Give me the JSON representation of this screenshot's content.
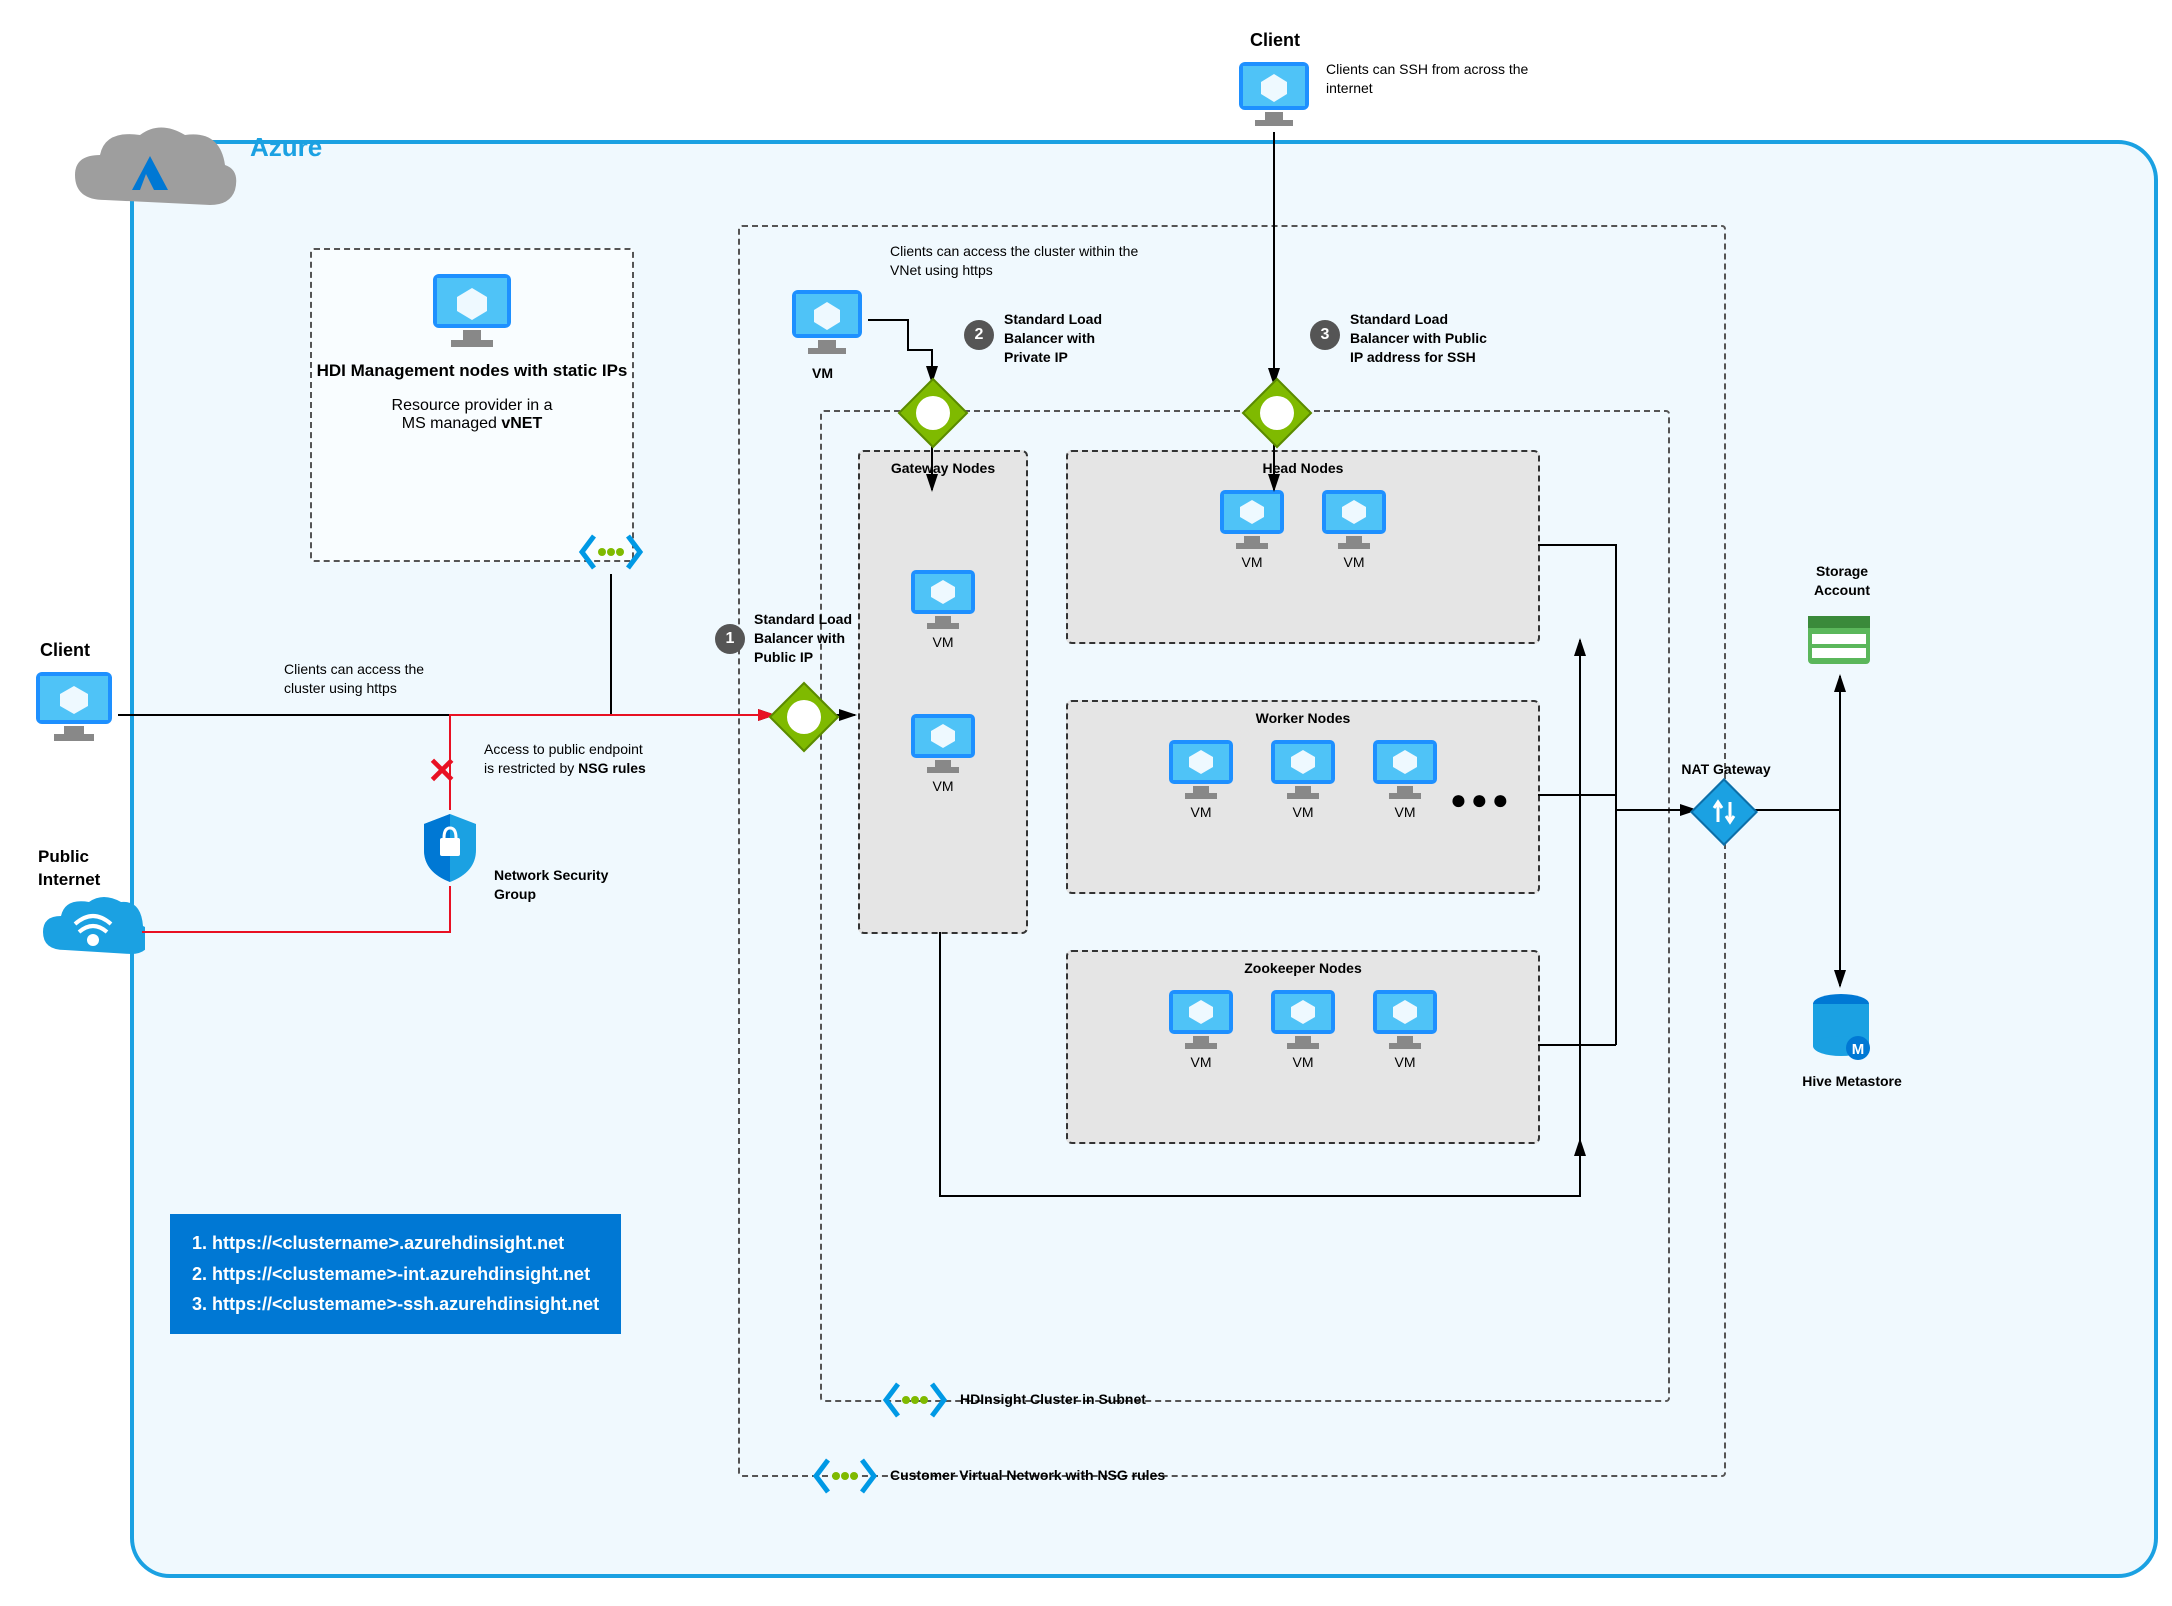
{
  "azure": {
    "title": "Azure"
  },
  "client_top": {
    "title": "Client",
    "desc": "Clients can SSH from across the internet"
  },
  "client_left": {
    "title": "Client",
    "desc": "Clients can access the cluster using https"
  },
  "public_internet": {
    "title": "Public Internet"
  },
  "hdi_mgmt": {
    "title": "HDI Management nodes with static IPs",
    "desc_a": "Resource provider in a",
    "desc_b": "MS managed ",
    "desc_c": "vNET"
  },
  "nsg": {
    "desc": "Access to public endpoint is restricted by ",
    "bold": "NSG rules",
    "label": "Network Security Group"
  },
  "vm_caption": {
    "label": "VM",
    "desc": "Clients can access the cluster within the VNet using https"
  },
  "lb1": {
    "num": "1",
    "label_a": "Standard Load",
    "label_b": "Balancer with",
    "label_c": "Public IP"
  },
  "lb2": {
    "num": "2",
    "label_a": "Standard Load",
    "label_b": "Balancer with",
    "label_c": "Private IP"
  },
  "lb3": {
    "num": "3",
    "label_a": "Standard Load",
    "label_b": "Balancer with Public",
    "label_c": "IP address for SSH"
  },
  "panels": {
    "gateway": {
      "title": "Gateway Nodes",
      "vm": "VM"
    },
    "head": {
      "title": "Head Nodes",
      "vm": "VM"
    },
    "worker": {
      "title": "Worker Nodes",
      "vm": "VM"
    },
    "zoo": {
      "title": "Zookeeper Nodes",
      "vm": "VM"
    }
  },
  "nat": {
    "label": "NAT Gateway"
  },
  "storage": {
    "label": "Storage Account"
  },
  "hive": {
    "label": "Hive Metastore"
  },
  "subnet_label": "HDInsight Cluster in Subnet",
  "vnet_label": "Customer Virtual Network with NSG rules",
  "urls": {
    "u1": "1. https://<clustername>.azurehdinsight.net",
    "u2": "2. https://<clustemame>-int.azurehdinsight.net",
    "u3": "3. https://<clustemame>-ssh.azurehdinsight.net"
  }
}
